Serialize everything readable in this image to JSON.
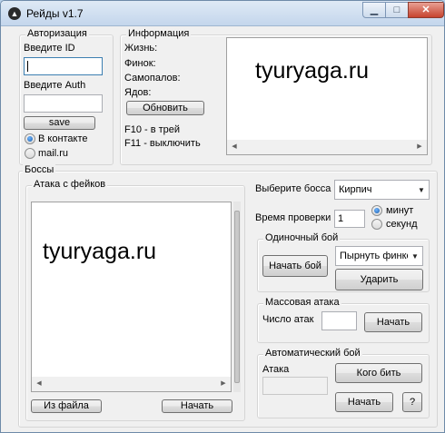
{
  "window": {
    "title": "Рейды v1.7",
    "icon": "app-icon"
  },
  "auth": {
    "legend": "Авторизация",
    "id_label": "Введите ID",
    "id_value": "",
    "auth_label": "Введите Auth",
    "auth_value": "",
    "save_label": "save",
    "radio_vk": "В контакте",
    "radio_mail": "mail.ru",
    "selected": "vk"
  },
  "info": {
    "legend": "Информация",
    "life": "Жизнь:",
    "finok": "Финок:",
    "samopal": "Самопалов:",
    "yad": "Ядов:",
    "refresh_label": "Обновить",
    "hotkey1": "F10 - в трей",
    "hotkey2": "F11 - выключить",
    "preview_text": "tyuryaga.ru"
  },
  "bosses": {
    "legend": "Боссы",
    "fake_attack_legend": "Атака с фейков",
    "log_text": "tyuryaga.ru",
    "from_file_label": "Из файла",
    "start_label": "Начать",
    "choose_boss_label": "Выберите босса",
    "boss_selected": "Кирпич",
    "check_time_label": "Время проверки",
    "check_time_value": "1",
    "radio_min": "минут",
    "radio_sec": "секунд",
    "time_unit_selected": "min"
  },
  "single": {
    "legend": "Одиночный бой",
    "start_label": "Начать бой",
    "action_selected": "Пырнуть финко",
    "hit_label": "Ударить"
  },
  "mass": {
    "legend": "Массовая атака",
    "count_label": "Число атак",
    "count_value": "",
    "start_label": "Начать"
  },
  "auto": {
    "legend": "Автоматический бой",
    "attack_label": "Атака",
    "who_label": "Кого бить",
    "start_label": "Начать",
    "help_label": "?"
  }
}
